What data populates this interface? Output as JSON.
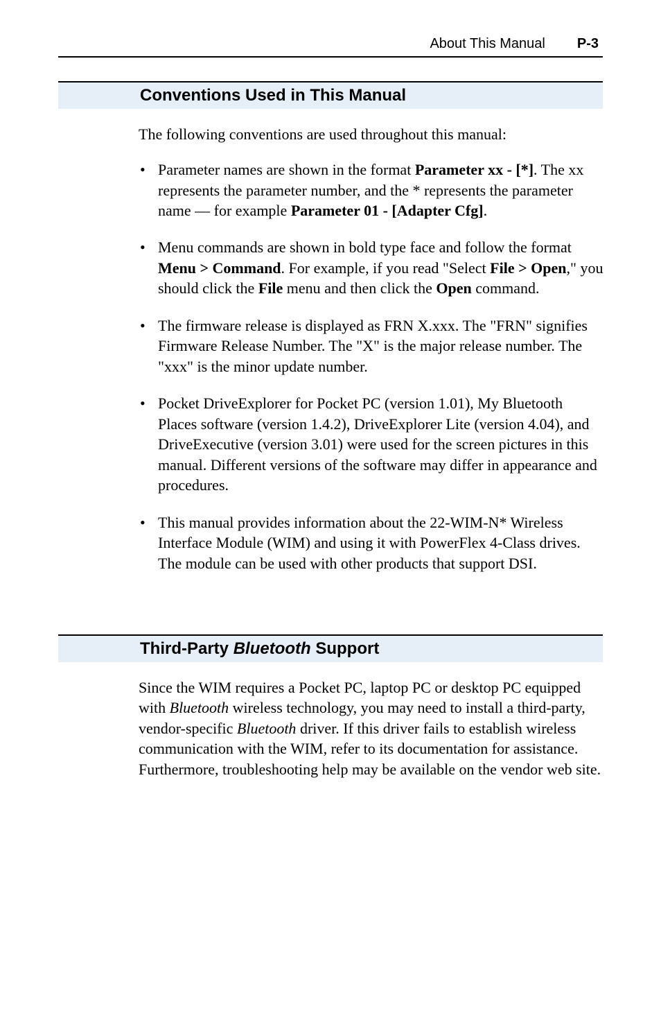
{
  "header": {
    "title": "About This Manual",
    "page": "P-3"
  },
  "section1": {
    "heading": "Conventions Used in This Manual",
    "intro": "The following conventions are used throughout this manual:",
    "bullets": {
      "b0": {
        "t0": "Parameter names are shown in the format ",
        "t1": "Parameter xx - [*]",
        "t2": ". The xx represents the parameter number, and the * represents the parameter name — for example ",
        "t3": "Parameter 01 - [Adapter Cfg]",
        "t4": "."
      },
      "b1": {
        "t0": "Menu commands are shown in bold type face and follow the format ",
        "t1": "Menu > Command",
        "t2": ". For example, if you read \"Select ",
        "t3": "File > Open",
        "t4": ",\" you should click the ",
        "t5": "File",
        "t6": " menu and then click the ",
        "t7": "Open",
        "t8": " command."
      },
      "b2": {
        "t0": "The firmware release is displayed as FRN X.xxx. The \"FRN\" signifies Firmware Release Number. The \"X\" is the major release number. The \"xxx\" is the minor update number."
      },
      "b3": {
        "t0": "Pocket DriveExplorer for Pocket PC (version 1.01), My Bluetooth Places software (version 1.4.2), DriveExplorer Lite (version 4.04), and DriveExecutive (version 3.01) were used for the screen pictures in this manual. Different versions of the software may differ in appearance and procedures."
      },
      "b4": {
        "t0": "This manual provides information about the 22-WIM-N* Wireless Interface Module (WIM) and using it with PowerFlex 4-Class drives. The module can be used with other products that support DSI."
      }
    }
  },
  "section2": {
    "heading_pre": "Third-Party ",
    "heading_italic": "Bluetooth",
    "heading_post": " Support",
    "body": {
      "t0": "Since the WIM requires a Pocket PC, laptop PC or desktop PC equipped with ",
      "t1": "Bluetooth",
      "t2": " wireless technology, you may need to install a third-party, vendor-specific ",
      "t3": "Bluetooth",
      "t4": " driver. If this driver fails to establish wireless communication with the WIM, refer to its documentation for assistance. Furthermore, troubleshooting help may be available on the vendor web site."
    }
  }
}
